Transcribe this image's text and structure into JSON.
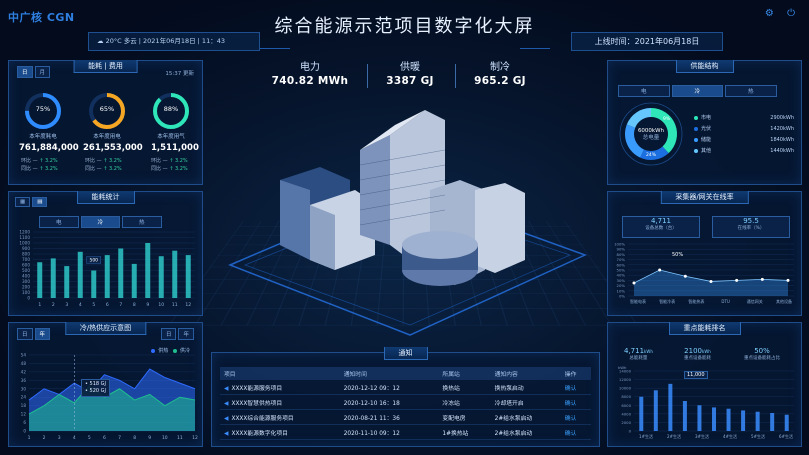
{
  "header": {
    "logo": "中广核 CGN",
    "title": "综合能源示范项目数字化大屏",
    "weather": "20°C  多云  |  2021年06月18日  |  11：43",
    "uptime": "上线时间：2021年06月18日",
    "icons": [
      "settings-icon",
      "power-icon"
    ]
  },
  "kpis": [
    {
      "label": "电力",
      "value": "740.82 MWh"
    },
    {
      "label": "供暖",
      "value": "3387 GJ"
    },
    {
      "label": "制冷",
      "value": "965.2 GJ"
    }
  ],
  "energy_panel": {
    "tabs": [
      "日",
      "月"
    ],
    "title_left": "能耗",
    "title_right": "费用",
    "updated": "15:37 更新",
    "rings": [
      {
        "pct": "75%",
        "pct_value": 0.75,
        "label": "本年度耗电",
        "color": "#2e8cff",
        "total": "761,884,000",
        "mom": "↑ 3.2%",
        "yoy": "↑ 3.2%"
      },
      {
        "pct": "65%",
        "pct_value": 0.65,
        "label": "本年度用电",
        "color": "#f5a623",
        "total": "261,553,000",
        "mom": "↑ 3.2%",
        "yoy": "↑ 3.2%"
      },
      {
        "pct": "88%",
        "pct_value": 0.88,
        "label": "本年度用气",
        "color": "#2ee6b8",
        "total": "1,511,000",
        "mom": "↑ 3.2%",
        "yoy": "↑ 3.2%"
      }
    ],
    "mom_label": "环比",
    "yoy_label": "同比"
  },
  "stats_panel": {
    "title": "能耗统计",
    "tabs": [
      "电",
      "冷",
      "热"
    ],
    "highlight": "500"
  },
  "cooling_panel": {
    "title": "冷/热供应示意图",
    "tabs": [
      "日",
      "年"
    ],
    "legend": [
      "供热",
      "供冷"
    ],
    "tooltip1": "• 518 GJ",
    "tooltip2": "• 520 GJ"
  },
  "supply_panel": {
    "title": "供能结构",
    "tabs": [
      "电",
      "冷",
      "热"
    ],
    "donut_center": "6000kWh",
    "donut_sub": "总电量",
    "slices": [
      {
        "name": "市电",
        "value": "2900kWh",
        "pct": "9%",
        "color": "#2ee6b8"
      },
      {
        "name": "光伏",
        "value": "1420kWh",
        "pct": "",
        "color": "#1b6fe0"
      },
      {
        "name": "储能",
        "value": "1840kWh",
        "pct": "",
        "color": "#3a9bff"
      },
      {
        "name": "其他",
        "value": "1440kWh",
        "pct": "24%",
        "color": "#66c7ff"
      }
    ]
  },
  "collector_panel": {
    "title": "采集器/网关在线率",
    "stat1_value": "4,711",
    "stat1_label": "设备总数（台）",
    "stat2_value": "95.5",
    "stat2_label": "在线率（%）",
    "peak": "50%"
  },
  "ranking_panel": {
    "title": "重点能耗排名",
    "stat1_value": "4,711",
    "stat1_unit": "kWh",
    "stat1_label": "总能耗量",
    "stat2_value": "2100",
    "stat2_unit": "kWh",
    "stat2_label": "重点设备能耗",
    "stat3_value": "50%",
    "stat3_label": "重点设备能耗占比",
    "peak": "11,000"
  },
  "notice_panel": {
    "title": "通知",
    "columns": [
      "项目",
      "通知时间",
      "所属站",
      "通知内容",
      "操作"
    ],
    "rows": [
      {
        "project": "XXXX能源服务项目",
        "time": "2020-12-12  09：12",
        "station": "换热站",
        "content": "换热泵启动",
        "op": "确认"
      },
      {
        "project": "XXXX智慧供热项目",
        "time": "2020-12-10  16：18",
        "station": "冷冻站",
        "content": "冷却塔开启",
        "op": "确认"
      },
      {
        "project": "XXXX综合能源服务项目",
        "time": "2020-08-21  11：36",
        "station": "变配电房",
        "content": "2#给水泵启动",
        "op": "确认"
      },
      {
        "project": "XXXX能源数字化项目",
        "time": "2020-11-10  09：12",
        "station": "1#换热站",
        "content": "2#给水泵启动",
        "op": "确认"
      }
    ]
  },
  "chart_data": [
    {
      "type": "bar",
      "title": "能耗统计",
      "categories": [
        "1",
        "2",
        "3",
        "4",
        "5",
        "6",
        "7",
        "8",
        "9",
        "10",
        "11",
        "12"
      ],
      "values": [
        650,
        720,
        580,
        840,
        500,
        780,
        900,
        620,
        1000,
        760,
        860,
        780
      ],
      "ylim": [
        0,
        1200
      ],
      "yticks": [
        0,
        100,
        200,
        300,
        400,
        500,
        600,
        700,
        800,
        900,
        1000,
        1100,
        1200
      ],
      "color": "#2ec8c8"
    },
    {
      "type": "area",
      "title": "冷/热供应示意图",
      "categories": [
        "1",
        "2",
        "3",
        "4",
        "5",
        "6",
        "7",
        "8",
        "9",
        "10",
        "11",
        "12"
      ],
      "yticks": [
        0,
        6,
        12,
        18,
        24,
        30,
        36,
        42,
        48,
        54
      ],
      "ylim": [
        0,
        54
      ],
      "series": [
        {
          "name": "供热",
          "values": [
            22,
            30,
            26,
            34,
            28,
            40,
            36,
            30,
            44,
            38,
            34,
            30
          ],
          "color": "#2e6bff"
        },
        {
          "name": "供冷",
          "values": [
            12,
            18,
            26,
            20,
            32,
            24,
            30,
            22,
            26,
            18,
            24,
            22
          ],
          "color": "#1fbf8f"
        }
      ]
    },
    {
      "type": "pie",
      "title": "供能结构",
      "slices": [
        {
          "name": "市电",
          "value": 2900
        },
        {
          "name": "光伏",
          "value": 1420
        },
        {
          "name": "储能",
          "value": 1840
        },
        {
          "name": "其他",
          "value": 1440
        }
      ]
    },
    {
      "type": "area",
      "title": "采集器/网关在线率",
      "categories": [
        "智能电表",
        "智能冷表",
        "智能热表",
        "DTU",
        "通信网关",
        "其他设备"
      ],
      "yticks": [
        "0%",
        "10%",
        "20%",
        "30%",
        "40%",
        "50%",
        "60%",
        "70%",
        "80%",
        "90%",
        "100%"
      ],
      "ylim": [
        0,
        100
      ],
      "values": [
        25,
        50,
        38,
        28,
        30,
        32,
        30
      ],
      "color": "#3a9bff"
    },
    {
      "type": "bar",
      "title": "重点能耗排名",
      "categories": [
        "1#生活",
        "2#生活",
        "3#生活",
        "4#生活",
        "5#生活",
        "6#生活"
      ],
      "values": [
        8000,
        9500,
        11000,
        7000,
        6000,
        5500,
        5200,
        4800,
        4500,
        4200,
        3800
      ],
      "ylim": [
        0,
        14000
      ],
      "yticks": [
        "0",
        "2000",
        "4000",
        "6000",
        "8000",
        "10000",
        "12000",
        "14000"
      ],
      "ylabel": "kWh",
      "color": "#3a8cff"
    }
  ]
}
